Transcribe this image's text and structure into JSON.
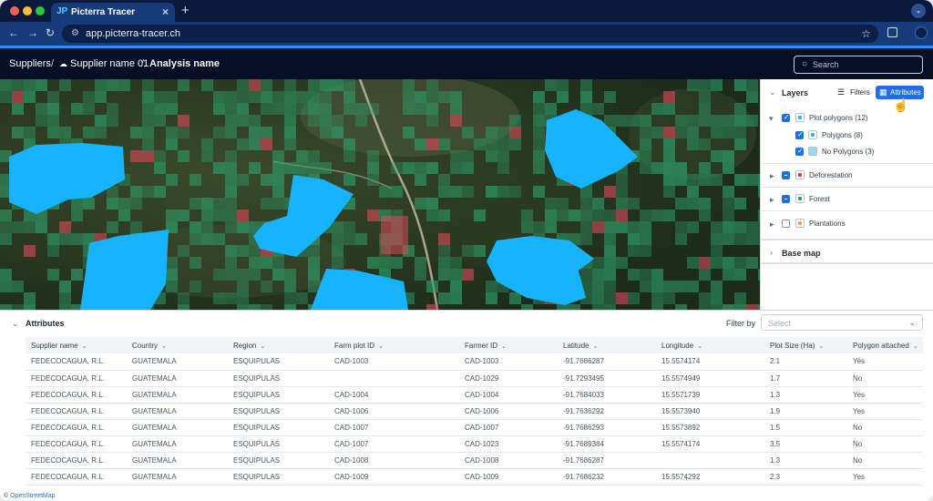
{
  "browser": {
    "tab_title": "Picterra Tracer",
    "tab_logo": "JP",
    "url": "app.picterra-tracer.ch",
    "colors": {
      "tabbar": "#0b1a3c",
      "toolbar": "#173b7a",
      "accent": "#2f8cff"
    }
  },
  "header": {
    "breadcrumb": [
      "Suppliers",
      "Supplier name 01",
      "Analysis name"
    ],
    "separator": "/",
    "search_placeholder": "Search"
  },
  "layers": {
    "title": "Layers",
    "filters_label": "Filters",
    "attributes_label": "Attributes",
    "items": [
      {
        "label": "Plot polygons (12)",
        "checked": "true",
        "swatch": "#29b6f6"
      },
      {
        "label": "Polygons (8)",
        "checked": "true",
        "swatch": "#29b6f6"
      },
      {
        "label": "No Polygons (3)",
        "checked": "true",
        "swatch": "#9bd7f0"
      },
      {
        "label": "Deforestation",
        "checked": "partial",
        "swatch": "#e53935"
      },
      {
        "label": "Forest",
        "checked": "partial",
        "swatch": "#2e9e6b"
      },
      {
        "label": "Plantations",
        "checked": "false",
        "swatch": "#f0a43a"
      }
    ],
    "base_map_label": "Base map"
  },
  "attributes": {
    "title": "Attributes",
    "filter_by_label": "Filter by",
    "filter_placeholder": "Select",
    "columns": [
      "Supplier name",
      "Country",
      "Region",
      "Farm plot ID",
      "Farmer ID",
      "Latitude",
      "Longitude",
      "Plot Size (Ha)",
      "Polygon attached"
    ],
    "rows": [
      [
        "FEDECOCAGUA, R.L.",
        "GUATEMALA",
        "ESQUIPULAS",
        "CAD-1003",
        "CAD-1003",
        "-91.7686287",
        "15.5574174",
        "2.1",
        "Yes"
      ],
      [
        "FEDECOCAGUA, R.L.",
        "GUATEMALA",
        "ESQUIPULAS",
        "",
        "CAD-1029",
        "-91.7293495",
        "15.5574949",
        "1.7",
        "No"
      ],
      [
        "FEDECOCAGUA, R.L.",
        "GUATEMALA",
        "ESQUIPULAS",
        "CAD-1004",
        "CAD-1004",
        "-91.7684033",
        "15.5571739",
        "1.3",
        "Yes"
      ],
      [
        "FEDECOCAGUA, R.L.",
        "GUATEMALA",
        "ESQUIPULAS",
        "CAD-1006",
        "CAD-1006",
        "-91.7636292",
        "15.5573940",
        "1.9",
        "Yes"
      ],
      [
        "FEDECOCAGUA, R.L.",
        "GUATEMALA",
        "ESQUIPULAS",
        "CAD-1007",
        "CAD-1007",
        "-91.7686293",
        "15.5573892",
        "1.5",
        "No"
      ],
      [
        "FEDECOCAGUA, R.L.",
        "GUATEMALA",
        "ESQUIPULAS",
        "CAD-1007",
        "CAD-1023",
        "-91.7689384",
        "15.5574174",
        "3.5",
        "No"
      ],
      [
        "FEDECOCAGUA, R.L.",
        "GUATEMALA",
        "ESQUIPULAS",
        "CAD-1008",
        "CAD-1008",
        "-91.7686287",
        "",
        "1.3",
        "No"
      ],
      [
        "FEDECOCAGUA, R.L.",
        "GUATEMALA",
        "ESQUIPULAS",
        "CAD-1009",
        "CAD-1009",
        "-91.7686232",
        "15.5574292",
        "2.3",
        "Yes"
      ]
    ]
  },
  "map": {
    "attribution_symbol": "©",
    "attribution_link": "OpenStreetMap",
    "colors": {
      "forest": "#2e9e6b",
      "deforestation": "#e0485a",
      "plot_polygon": "#16b4ff"
    }
  }
}
